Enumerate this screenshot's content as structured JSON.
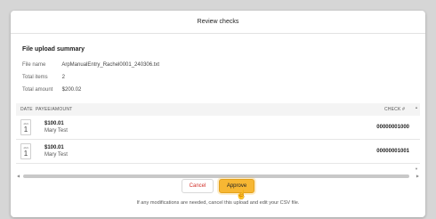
{
  "modal": {
    "title": "Review checks"
  },
  "summary": {
    "heading": "File upload summary",
    "file_name_label": "File name",
    "file_name_value": "ArpManualEntry_Rachel0001_240306.txt",
    "total_items_label": "Total items",
    "total_items_value": "2",
    "total_amount_label": "Total amount",
    "total_amount_value": "$200.02"
  },
  "table": {
    "headers": {
      "date": "DATE",
      "payee": "PAYEE/AMOUNT",
      "check": "CHECK #"
    },
    "rows": [
      {
        "month": "JAN",
        "day": "1",
        "amount": "$100.01",
        "payee": "Mary Test",
        "check": "00000001000"
      },
      {
        "month": "JAN",
        "day": "1",
        "amount": "$100.01",
        "payee": "Mary Test",
        "check": "00000001001"
      }
    ]
  },
  "actions": {
    "cancel_label": "Cancel",
    "approve_label": "Approve"
  },
  "note": "If any modifications are needed, cancel this upload and edit your CSV file.",
  "colors": {
    "approve_bg": "#f7b733",
    "cancel_text": "#d2302a"
  }
}
